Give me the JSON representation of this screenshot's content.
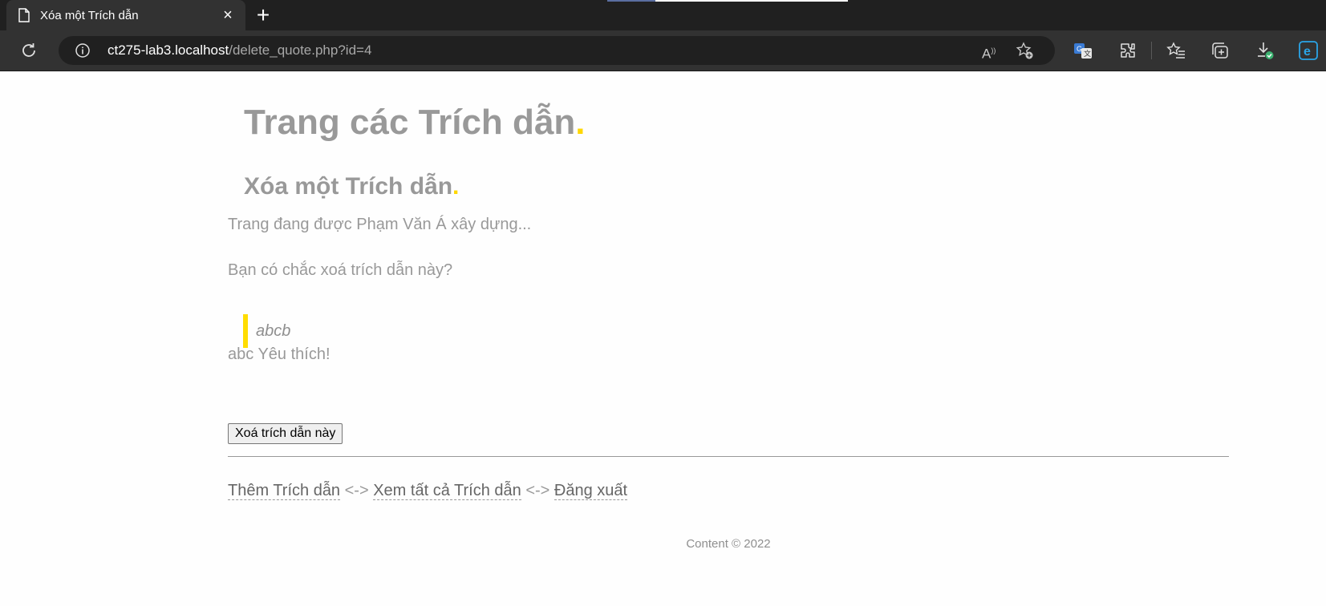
{
  "browser": {
    "tab_title": "Xóa một Trích dẫn",
    "url_host": "ct275-lab3.localhost",
    "url_path": "/delete_quote.php?id=4"
  },
  "page": {
    "site_title": "Trang các Trích dẫn",
    "site_title_dot": ".",
    "heading": "Xóa một Trích dẫn",
    "heading_dot": ".",
    "building_note": "Trang đang được Phạm Văn Á xây dựng...",
    "confirm_question": "Bạn có chắc xoá trích dẫn này?",
    "quote_text": "abcb",
    "quote_author": "abc Yêu thích!",
    "delete_button_label": "Xoá trích dẫn này",
    "nav": {
      "add_quote": "Thêm Trích dẫn",
      "separator": "<->",
      "view_all": "Xem tất cả Trích dẫn",
      "logout": "Đăng xuất"
    },
    "footer": "Content © 2022"
  },
  "colors": {
    "accent_yellow": "#ffd700",
    "text_gray": "#999999",
    "browser_dark": "#202020"
  },
  "icons": [
    "page-icon",
    "close-icon",
    "new-tab-icon",
    "reload-icon",
    "info-icon",
    "read-aloud-icon",
    "add-favorite-icon",
    "translate-icon",
    "extensions-icon",
    "favorites-icon",
    "collections-icon",
    "downloads-icon",
    "edge-icon"
  ]
}
